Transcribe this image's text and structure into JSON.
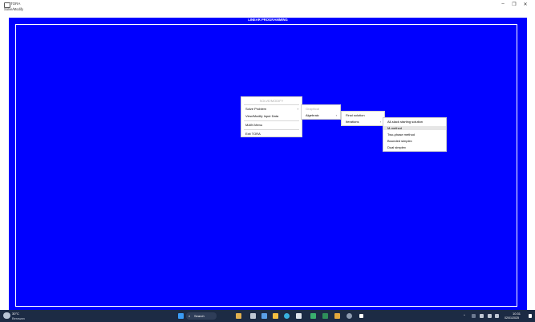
{
  "window": {
    "title": "TORA",
    "menu_label": "Solve/Modify",
    "minimize": "–",
    "maximize": "❐",
    "close": "✕"
  },
  "frame": {
    "title": "LINEAR PROGRAMMING",
    "background": "#0000ff"
  },
  "main_menu": {
    "header": "SOLVE/MODIFY",
    "items": [
      {
        "label": "Solve Problem",
        "arrow": "›"
      },
      {
        "label": "View/Modify Input Data"
      },
      {
        "label": "MAIN Menu"
      },
      {
        "label": "Exit TORA"
      }
    ]
  },
  "submenu_1": {
    "items": [
      {
        "label": "Graphical",
        "disabled": true
      },
      {
        "label": "Algebraic",
        "arrow": "›"
      }
    ]
  },
  "submenu_2": {
    "items": [
      {
        "label": "Final solution"
      },
      {
        "label": "Iterations",
        "arrow": "›"
      }
    ]
  },
  "submenu_3": {
    "items": [
      {
        "label": "All-slack starting solution"
      },
      {
        "label": "M-method",
        "highlighted": true
      },
      {
        "label": "Two-phase method"
      },
      {
        "label": "Bounded simplex"
      },
      {
        "label": "Dual simplex"
      }
    ]
  },
  "taskbar": {
    "weather_temp": "30°C",
    "weather_desc": "Berawan",
    "search_label": "Search",
    "time": "10:31",
    "date": "02/01/2025",
    "background": "#1c2b44"
  }
}
